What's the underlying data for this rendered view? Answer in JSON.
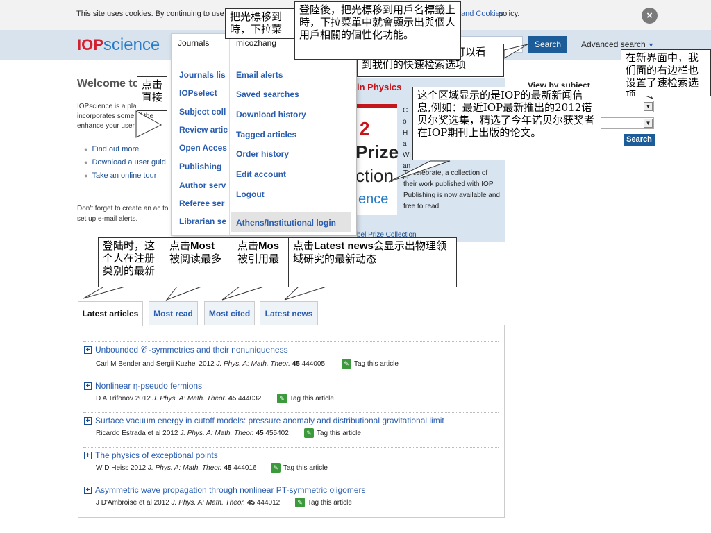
{
  "cookie_bar": {
    "text": "This site uses cookies. By continuing to use this",
    "link": "and Cookies",
    "rest": "policy.",
    "close": "×"
  },
  "header": {
    "logo_iop": "IOP",
    "logo_science": "science",
    "search_button": "Search",
    "advanced_search": "Advanced search"
  },
  "journals_menu": {
    "label": "Journals",
    "items": [
      "Journals lis",
      "IOPselect",
      "Subject coll",
      "Review artic",
      "Open Acces",
      "Publishing",
      "Author serv",
      "Referee ser",
      "Librarian se"
    ]
  },
  "user_menu": {
    "label": "micozhang",
    "items": [
      "Email alerts",
      "Saved searches",
      "Download history",
      "Tagged articles",
      "Order history",
      "Edit account",
      "Logout"
    ],
    "athens": "Athens/Institutional login"
  },
  "welcome": {
    "title": "Welcome to",
    "intro": "IOPscience is a pla incorporates some of the enhance your user ex",
    "links": [
      "Find out more",
      "Download a user guid",
      "Take an online tour"
    ],
    "reminder": "Don't forget to create an ac to set up e-mail alerts."
  },
  "feature": {
    "red_title": "in Physics",
    "img_2": "2",
    "img_prize": "Prize",
    "img_ction": "ction",
    "img_ence": "ence",
    "right_text": "Co Ha Wi an Fr",
    "desc": "To celebrate, a collection of their work published with IOP Publishing is now available and free to read.",
    "link": "bel Prize Collection"
  },
  "sidebar": {
    "title": "View by subject",
    "search_button": "Search"
  },
  "callouts": {
    "c1": "把光標移到",
    "c1b": "時，下拉菜",
    "c2": "登陸後，把光標移到用戶名標籤上時，下拉菜單中就會顯示出與個人用戶相關的個性化功能。",
    "c3a": "可以看",
    "c3b": "到我们的快速检索选项",
    "c4": "在新界面中，我们面的右边栏也设置了速检索选项",
    "c5a": "点击",
    "c5b": "直接",
    "c6": "这个区域显示的是IOP的最新新闻信息,例如：最近IOP最新推出的2012诺贝尔奖选集，精选了今年诺贝尔获奖者在IOP期刊上出版的论文。",
    "c7": "登陆时，这个人在注册类别的最新",
    "c8a": "点击",
    "c8b": "Most",
    "c8c": "被阅读最多",
    "c9a": "点击",
    "c9b": "Mos",
    "c9c": "被引用最",
    "c10a": "点击",
    "c10b": "Latest news",
    "c10c": "会显示出物理领域研究的最新动态"
  },
  "tabs": [
    "Latest articles",
    "Most read",
    "Most cited",
    "Latest news"
  ],
  "articles": [
    {
      "title": "Unbounded  𝒞 -symmetries and their nonuniqueness",
      "authors": "Carl M Bender and Sergii Kuzhel 2012",
      "journal": "J. Phys. A: Math. Theor.",
      "volume": "45",
      "number": "444005",
      "tag": "Tag this article"
    },
    {
      "title": "Nonlinear η-pseudo fermions",
      "authors": "D A Trifonov 2012",
      "journal": "J. Phys. A: Math. Theor.",
      "volume": "45",
      "number": "444032",
      "tag": "Tag this article"
    },
    {
      "title": "Surface vacuum energy in cutoff models: pressure anomaly and distributional gravitational limit",
      "authors": "Ricardo Estrada et al 2012",
      "journal": "J. Phys. A: Math. Theor.",
      "volume": "45",
      "number": "455402",
      "tag": "Tag this article"
    },
    {
      "title": "The physics of exceptional points",
      "authors": "W D Heiss 2012",
      "journal": "J. Phys. A: Math. Theor.",
      "volume": "45",
      "number": "444016",
      "tag": "Tag this article"
    },
    {
      "title": "Asymmetric wave propagation through nonlinear PT-symmetric oligomers",
      "authors": "J D'Ambroise et al 2012",
      "journal": "J. Phys. A: Math. Theor.",
      "volume": "45",
      "number": "444012",
      "tag": "Tag this article"
    }
  ]
}
